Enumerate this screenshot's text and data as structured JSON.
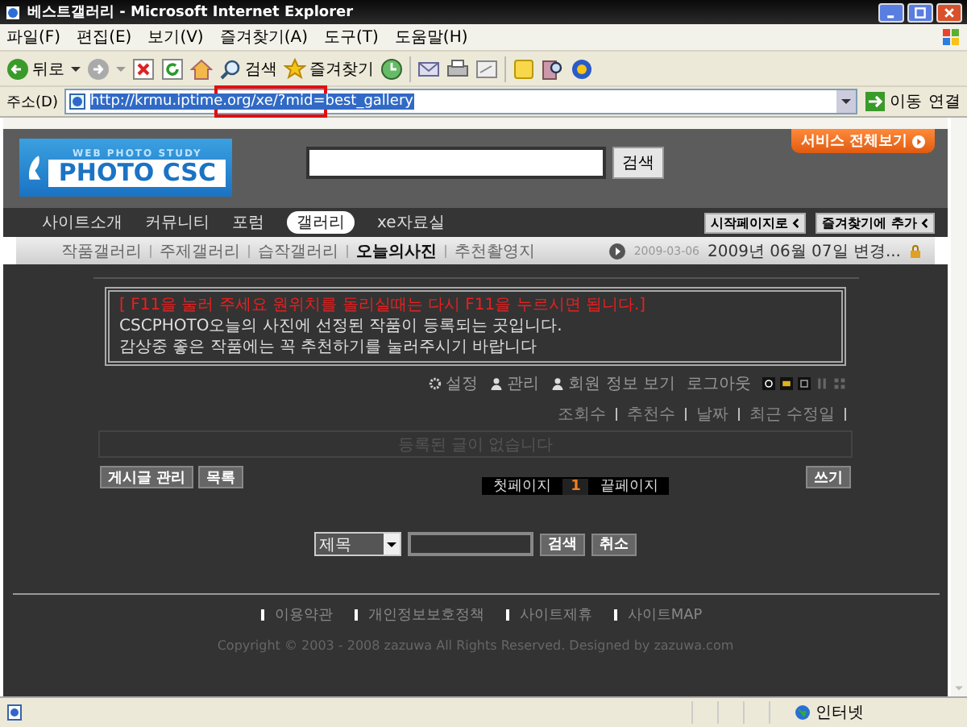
{
  "window": {
    "title": "베스트갤러리 - Microsoft Internet Explorer"
  },
  "menu": [
    "파일(F)",
    "편집(E)",
    "보기(V)",
    "즐겨찾기(A)",
    "도구(T)",
    "도움말(H)"
  ],
  "toolbar": {
    "back": "뒤로",
    "search": "검색",
    "favorites": "즐겨찾기"
  },
  "address": {
    "label": "주소(D)",
    "url": "http://krmu.iptime.org/xe/?mid=best_gallery",
    "go": "이동",
    "links": "연결"
  },
  "header": {
    "logo_tagline": "WEB PHOTO STUDY",
    "logo_title": "PHOTO CSC",
    "search_button": "검색",
    "service_button": "서비스 전체보기"
  },
  "nav": {
    "items": [
      {
        "label": "사이트소개",
        "selected": false
      },
      {
        "label": "커뮤니티",
        "selected": false
      },
      {
        "label": "포럼",
        "selected": false
      },
      {
        "label": "갤러리",
        "selected": true
      },
      {
        "label": "xe자료실",
        "selected": false
      }
    ],
    "buttons": [
      "시작페이지로",
      "즐겨찾기에 추가"
    ]
  },
  "subnav": {
    "items": [
      {
        "label": "작품갤러리",
        "selected": false
      },
      {
        "label": "주제갤러리",
        "selected": false
      },
      {
        "label": "습작갤러리",
        "selected": false
      },
      {
        "label": "오늘의사진",
        "selected": true
      },
      {
        "label": "추천촬영지",
        "selected": false
      }
    ],
    "date": "2009-03-06",
    "notice": "2009년 06월 07일 변경..."
  },
  "notice_box": [
    {
      "kind": "warning",
      "text": "[ F11을 눌러 주세요 원위치를 돌리실때는 다시 F11을 누르시면 됩니다.]"
    },
    {
      "kind": "normal",
      "text": "CSCPHOTO오늘의 사진에 선정된 작품이 등록되는 곳입니다."
    },
    {
      "kind": "normal",
      "text": "감상중 좋은 작품에는 꼭 추천하기를 눌러주시기 바랍니다"
    }
  ],
  "admin_links": [
    "설정",
    "관리",
    "회원 정보 보기",
    "로그아웃"
  ],
  "sort_links": [
    "조회수",
    "추천수",
    "날짜",
    "최근 수정일"
  ],
  "empty_message": "등록된 글이 없습니다",
  "board_buttons": [
    "게시글 관리",
    "목록"
  ],
  "write_button": "쓰기",
  "pagination": {
    "first": "첫페이지",
    "pages": [
      {
        "label": "1",
        "selected": true
      }
    ],
    "last": "끝페이지"
  },
  "search_form": {
    "field": "제목",
    "search": "검색",
    "cancel": "취소"
  },
  "footer_links": [
    "이용약관",
    "개인정보보호정책",
    "사이트제휴",
    "사이트MAP"
  ],
  "copyright": "Copyright © 2003 - 2008 zazuwa All Rights Reserved. Designed by zazuwa.com",
  "status_bar": {
    "zone": "인터넷"
  }
}
